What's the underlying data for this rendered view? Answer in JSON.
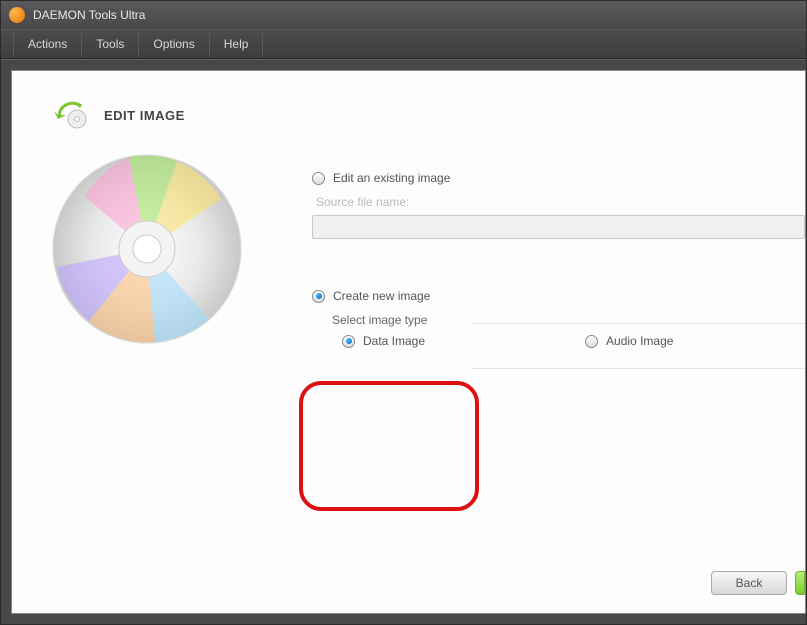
{
  "app": {
    "title": "DAEMON Tools Ultra"
  },
  "menu": {
    "actions": "Actions",
    "tools": "Tools",
    "options": "Options",
    "help": "Help"
  },
  "page": {
    "title": "EDIT IMAGE"
  },
  "edit_section": {
    "radio_label": "Edit an existing image",
    "source_label": "Source file name:",
    "source_value": ""
  },
  "create_section": {
    "radio_label": "Create new image",
    "subsection": "Select image type",
    "data_label": "Data Image",
    "audio_label": "Audio Image"
  },
  "footer": {
    "back": "Back"
  },
  "colors": {
    "highlight": "#d11"
  }
}
